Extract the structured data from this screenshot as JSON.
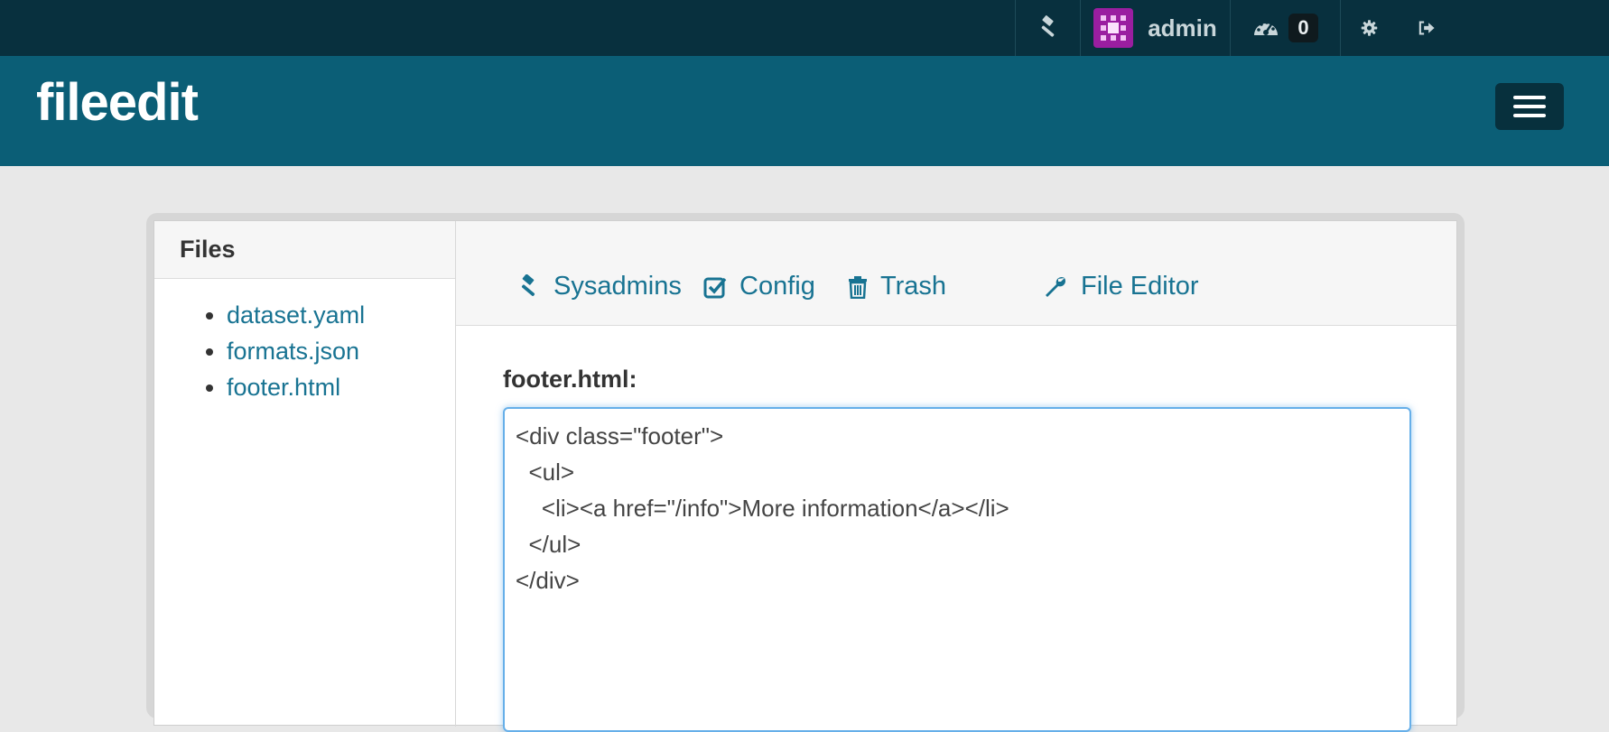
{
  "topbar": {
    "username": "admin",
    "activity_count": "0",
    "icons": [
      "gavel-icon",
      "avatar",
      "dashboard-icon",
      "gear-icon",
      "sign-out-icon"
    ]
  },
  "header": {
    "title": "fileedit"
  },
  "sidebar": {
    "heading": "Files",
    "files": [
      "dataset.yaml",
      "formats.json",
      "footer.html"
    ]
  },
  "tabs": [
    {
      "label": "Sysadmins",
      "icon": "gavel-icon"
    },
    {
      "label": "Config",
      "icon": "check-square-icon"
    },
    {
      "label": "Trash",
      "icon": "trash-icon"
    },
    {
      "label": "File Editor",
      "icon": "wrench-icon"
    }
  ],
  "editor": {
    "label": "footer.html:",
    "content": "<div class=\"footer\">\n  <ul>\n    <li><a href=\"/info\">More information</a></li>\n  </ul>\n</div>"
  },
  "colors": {
    "topbar": "#08303e",
    "masthead": "#0b5e76",
    "link": "#187392",
    "avatar": "#9a1ea0"
  }
}
